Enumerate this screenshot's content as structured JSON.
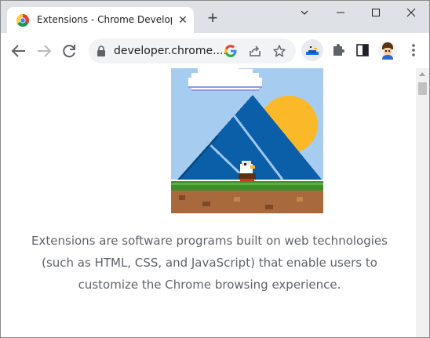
{
  "tab": {
    "title": "Extensions - Chrome Developers",
    "close_icon": "close-icon",
    "favicon": "chrome-logo-icon"
  },
  "window_controls": {
    "dropdown": "⌄",
    "minimize": "—",
    "maximize": "☐",
    "close": "✕"
  },
  "toolbar": {
    "url": "developer.chrome....",
    "back": "back-icon",
    "forward": "forward-icon",
    "reload": "reload-icon"
  },
  "content": {
    "description": "Extensions are software programs built on web technologies (such as HTML, CSS, and JavaScript) that enable users to customize the Chrome browsing experience."
  },
  "colors": {
    "tabstrip": "#dee1e6",
    "sky": "#a6cdef",
    "mountain": "#0b5ea8",
    "sun": "#fbb829",
    "grass": "#3f8d2c",
    "dirt": "#a86a3d"
  }
}
